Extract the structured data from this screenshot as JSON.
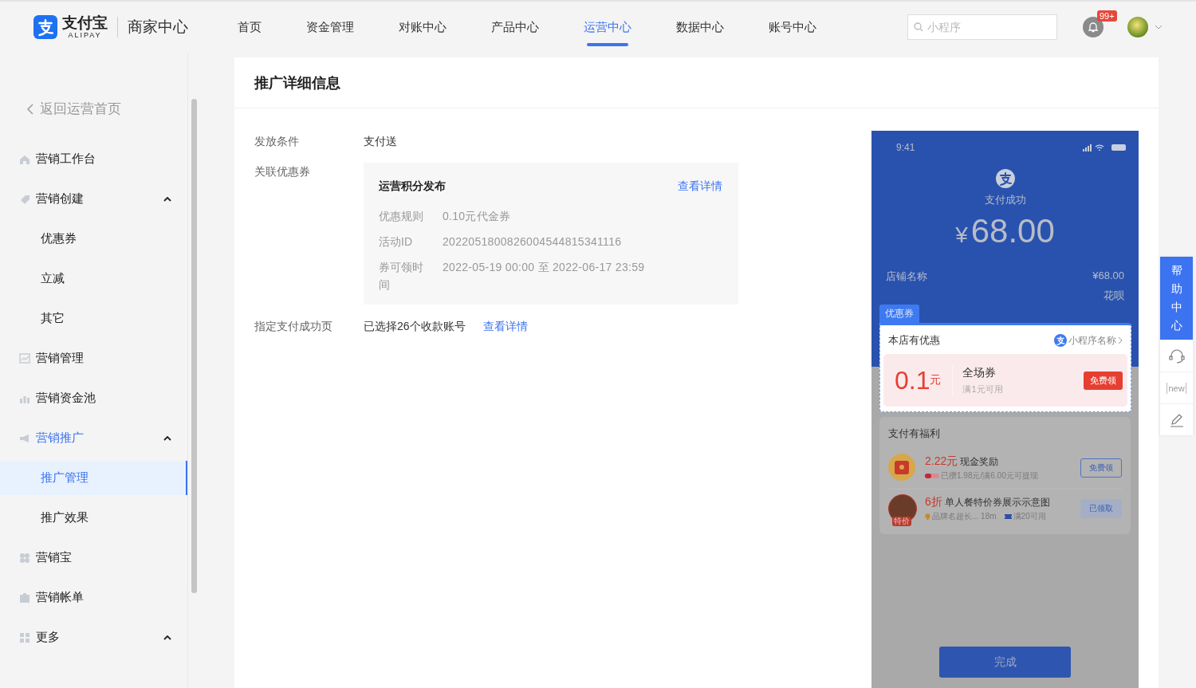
{
  "header": {
    "brand": "支付宝",
    "brand_sub": "ALIPAY",
    "portal": "商家中心",
    "nav": [
      {
        "label": "首页",
        "selected": false
      },
      {
        "label": "资金管理",
        "selected": false
      },
      {
        "label": "对账中心",
        "selected": false
      },
      {
        "label": "产品中心",
        "selected": false
      },
      {
        "label": "运营中心",
        "selected": true
      },
      {
        "label": "数据中心",
        "selected": false
      },
      {
        "label": "账号中心",
        "selected": false
      }
    ],
    "search": {
      "placeholder": "小程序"
    },
    "badge": "99+"
  },
  "sidebar": {
    "back": "返回运营首页",
    "items": [
      {
        "label": "营销工作台",
        "kind": "home",
        "selected": false
      },
      {
        "label": "营销创建",
        "kind": "tag",
        "selected": false,
        "expanded": true,
        "children": [
          {
            "label": "优惠券",
            "selected": false
          },
          {
            "label": "立减",
            "selected": false
          },
          {
            "label": "其它",
            "selected": false
          }
        ]
      },
      {
        "label": "营销管理",
        "kind": "chart",
        "selected": false
      },
      {
        "label": "营销资金池",
        "kind": "pool",
        "selected": false
      },
      {
        "label": "营销推广",
        "kind": "megaphone",
        "selected": false,
        "expanded": true,
        "children": [
          {
            "label": "推广管理",
            "selected": true
          },
          {
            "label": "推广效果",
            "selected": false
          }
        ]
      },
      {
        "label": "营销宝",
        "kind": "clover",
        "selected": false
      },
      {
        "label": "营销帐单",
        "kind": "clipboard",
        "selected": false
      },
      {
        "label": "更多",
        "kind": "grid",
        "selected": false,
        "expanded": true
      }
    ]
  },
  "detail": {
    "title": "推广详细信息",
    "rows": [
      {
        "kind": "text",
        "label": "发放条件",
        "value": "支付送"
      },
      {
        "kind": "coupon",
        "label": "关联优惠券",
        "coupon": {
          "name": "运营积分发布",
          "link": "查看详情",
          "fields": [
            {
              "label": "优惠规则",
              "value": "0.10元代金券"
            },
            {
              "label": "活动ID",
              "value": "2022051800826004544815341116"
            },
            {
              "label": "券可领时间",
              "value": "2022-05-19 00:00 至 2022-06-17 23:59"
            }
          ]
        }
      },
      {
        "kind": "link",
        "label": "指定支付成功页",
        "value": "已选择26个收款账号",
        "link": "查看详情"
      }
    ]
  },
  "preview": {
    "time": "9:41",
    "status": "支付成功",
    "currency": "¥",
    "amount": "68.00",
    "rows": [
      {
        "label": "店铺名称",
        "value": "¥68.00"
      },
      {
        "value": "花呗"
      }
    ],
    "tag": "优惠券",
    "shop_title": "本店有优惠",
    "mini_app": "小程序名称",
    "coupon": {
      "amount": "0.1",
      "unit": "元",
      "name": "全场券",
      "condition": "满1元可用",
      "button": "免费领"
    },
    "benefits": {
      "title": "支付有福利",
      "items": [
        {
          "kind": "envelope",
          "highlight": "2.22元",
          "name": "现金奖励",
          "tags": [
            {
              "kind": "progress",
              "text": "已攒1.98元/满6.00元可提现"
            }
          ],
          "button": "免费领",
          "claimed": false
        },
        {
          "kind": "photo",
          "image_badge": "特价",
          "highlight": "6折",
          "name": "单人餐特价券展示示意图",
          "tags": [
            {
              "kind": "pin",
              "text": "品牌名超长... 18m"
            },
            {
              "kind": "ticket",
              "text": "满20可用"
            }
          ],
          "button": "已领取",
          "claimed": true
        }
      ]
    },
    "done": "完成"
  },
  "help": {
    "label": "帮助中心",
    "tools": [
      {
        "kind": "service"
      },
      {
        "kind": "new",
        "label": "new"
      },
      {
        "kind": "edit"
      }
    ]
  }
}
